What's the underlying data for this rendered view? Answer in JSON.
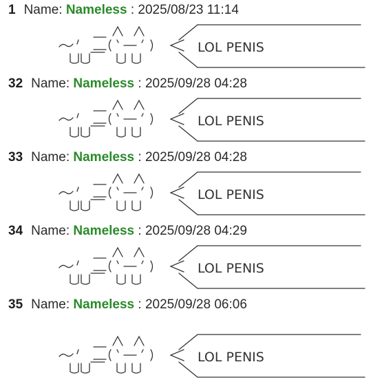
{
  "thread": {
    "name_label": "Name:",
    "separator": ":",
    "posts": [
      {
        "number": "1",
        "name": "Nameless",
        "date": "2025/08/23 11:14",
        "message": "LOL PENIS"
      },
      {
        "number": "32",
        "name": "Nameless",
        "date": "2025/09/28 04:28",
        "message": "LOL PENIS"
      },
      {
        "number": "33",
        "name": "Nameless",
        "date": "2025/09/28 04:28",
        "message": "LOL PENIS"
      },
      {
        "number": "34",
        "name": "Nameless",
        "date": "2025/09/28 04:29",
        "message": "LOL PENIS"
      },
      {
        "number": "35",
        "name": "Nameless",
        "date": "2025/09/28 06:06",
        "message": "LOL PENIS"
      }
    ]
  },
  "colors": {
    "name_color": "#2a8a2a",
    "text_color": "#2a2a2a",
    "background": "#ffffff"
  }
}
